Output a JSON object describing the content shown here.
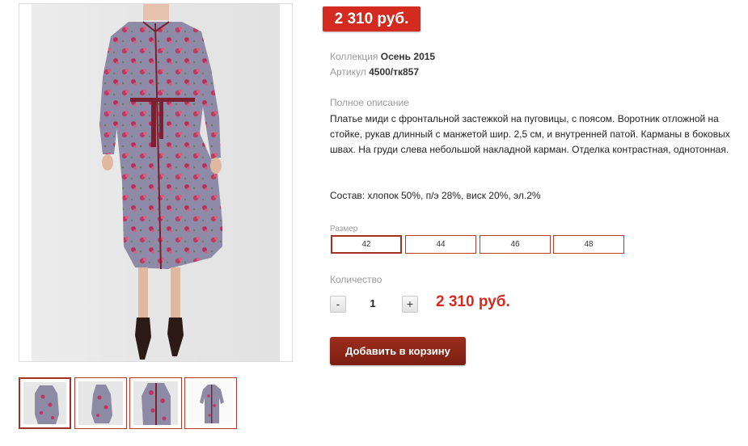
{
  "price_badge": "2 310 руб.",
  "meta": {
    "collection_label": "Коллекция",
    "collection_value": "Осень 2015",
    "sku_label": "Артикул",
    "sku_value": "4500/тк857"
  },
  "description": {
    "label": "Полное описание",
    "text": "Платье миди с фронтальной застежкой на пуговицы, с поясом. Воротник отложной на стойке, рукав длинный с манжетой шир. 2,5 см, и внутренней патой. Карманы в боковых швах. На груди слева небольшой накладной карман. Отделка контрастная, однотонная.",
    "composition": "Состав: хлопок 50%, п/э 28%, виск 20%, эл.2%"
  },
  "size": {
    "label": "Размер",
    "options": [
      "42",
      "44",
      "46",
      "48"
    ],
    "selected": "42"
  },
  "quantity": {
    "label": "Количество",
    "minus": "-",
    "plus": "+",
    "value": "1",
    "total": "2 310 руб."
  },
  "add_to_cart": "Добавить в корзину",
  "thumbnails": [
    {
      "name": "thumbnail-front",
      "active": true
    },
    {
      "name": "thumbnail-side",
      "active": false
    },
    {
      "name": "thumbnail-detail",
      "active": false
    },
    {
      "name": "thumbnail-flat",
      "active": false
    }
  ],
  "colors": {
    "accent": "#d42a20",
    "button": "#8a2617",
    "border": "#b73a2a",
    "dress": "#8d8aa6",
    "print": "#c0365e"
  }
}
